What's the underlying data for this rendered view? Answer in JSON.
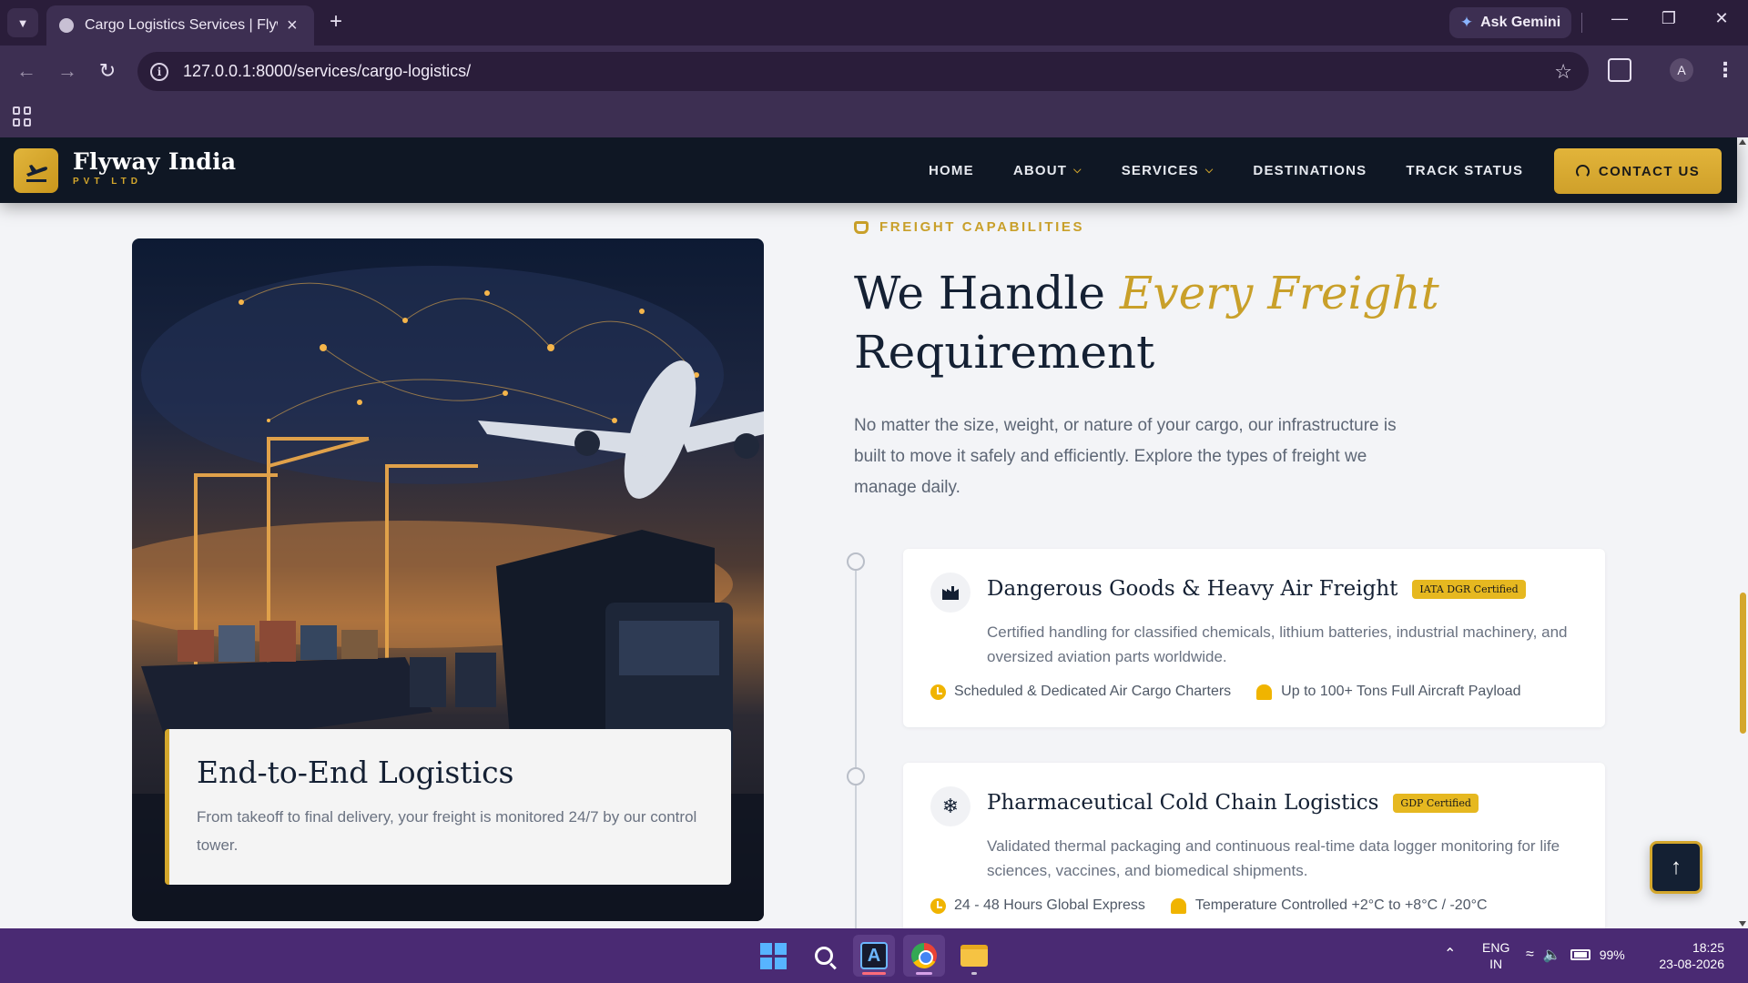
{
  "browser": {
    "tab_title": "Cargo Logistics Services | Flyway India",
    "url": "127.0.0.1:8000/services/cargo-logistics/",
    "gemini_label": "Ask Gemini",
    "profile_initial": "A"
  },
  "site": {
    "logo_name": "Flyway India",
    "logo_sub": "PVT LTD",
    "nav": [
      {
        "label": "HOME"
      },
      {
        "label": "ABOUT",
        "dropdown": true
      },
      {
        "label": "SERVICES",
        "dropdown": true
      },
      {
        "label": "DESTINATIONS"
      },
      {
        "label": "TRACK STATUS"
      }
    ],
    "contact_label": "CONTACT US",
    "accent_color": "#d4a72c",
    "navy_color": "#142033"
  },
  "hero_card": {
    "title": "End-to-End Logistics",
    "text": "From takeoff to final delivery, your freight is monitored 24/7 by our control tower."
  },
  "section": {
    "eyebrow": "FREIGHT CAPABILITIES",
    "headline_part1": "We Handle ",
    "headline_accent": "Every Freight",
    "headline_part2": "Requirement",
    "lead": "No matter the size, weight, or nature of your cargo, our infrastructure is built to move it safely and efficiently. Explore the types of freight we manage daily."
  },
  "features": [
    {
      "icon": "factory-icon",
      "title": "Dangerous Goods & Heavy Air Freight",
      "badge": "IATA DGR Certified",
      "desc": "Certified handling for classified chemicals, lithium batteries, industrial machinery, and oversized aviation parts worldwide.",
      "meta1": "Scheduled & Dedicated Air Cargo Charters",
      "meta2": "Up to 100+ Tons Full Aircraft Payload"
    },
    {
      "icon": "snowflake-icon",
      "title": "Pharmaceutical Cold Chain Logistics",
      "badge": "GDP Certified",
      "desc": "Validated thermal packaging and continuous real-time data logger monitoring for life sciences, vaccines, and biomedical shipments.",
      "meta1": "24 - 48 Hours Global Express",
      "meta2": "Temperature Controlled +2°C to +8°C / -20°C"
    }
  ],
  "taskbar": {
    "lang_line1": "ENG",
    "lang_line2": "IN",
    "battery": "99%",
    "time": "18:25",
    "date": "23-08-2026"
  }
}
